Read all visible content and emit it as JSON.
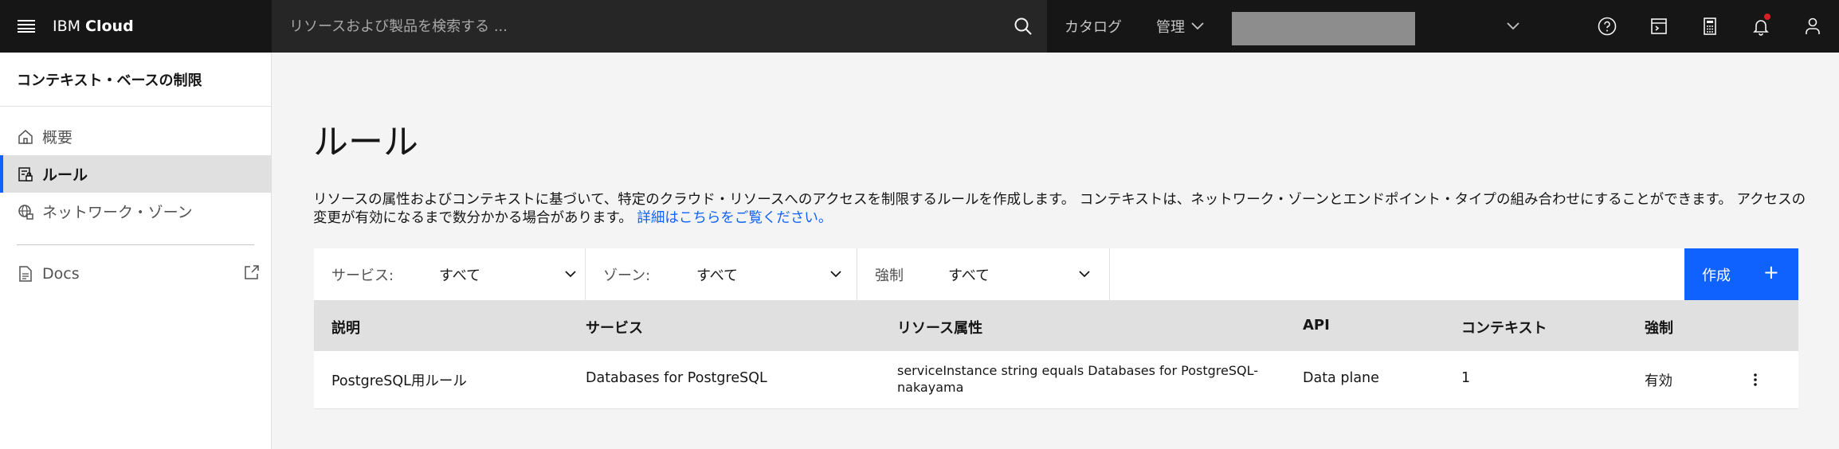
{
  "header": {
    "brand_prefix": "IBM",
    "brand_name": "Cloud",
    "search_placeholder": "リソースおよび製品を検索する ...",
    "catalog_label": "カタログ",
    "manage_label": "管理",
    "icons": [
      "hamburger-icon",
      "search-icon",
      "chevron-down-icon",
      "help-icon",
      "cost-estimator-icon",
      "calculator-icon",
      "notification-icon",
      "user-icon"
    ],
    "notification_dot_color": "#da1e28"
  },
  "sidebar": {
    "title": "コンテキスト・ベースの制限",
    "items": [
      {
        "label": "概要",
        "icon": "home-icon",
        "active": false
      },
      {
        "label": "ルール",
        "icon": "rule-icon",
        "active": true
      },
      {
        "label": "ネットワーク・ゾーン",
        "icon": "network-icon",
        "active": false
      }
    ],
    "docs_label": "Docs"
  },
  "main": {
    "title": "ルール",
    "description_line": "リソースの属性およびコンテキストに基づいて、特定のクラウド・リソースへのアクセスを制限するルールを作成します。 コンテキストは、ネットワーク・ゾーンとエンドポイント・タイプの組み合わせにすることができます。 アクセスの変更が有効になるまで数分かかる場合があります。",
    "description_link": "詳細はこちらをご覧ください。",
    "filters": [
      {
        "label": "サービス:",
        "value": "すべて"
      },
      {
        "label": "ゾーン:",
        "value": "すべて"
      },
      {
        "label": "強制",
        "value": "すべて"
      }
    ],
    "create_label": "作成",
    "create_plus": "+",
    "table": {
      "headers": [
        "説明",
        "サービス",
        "リソース属性",
        "API",
        "コンテキスト",
        "強制"
      ],
      "rows": [
        {
          "description": "PostgreSQL用ルール",
          "service": "Databases for PostgreSQL",
          "resource_attr": "serviceInstance string equals Databases for PostgreSQL-nakayama",
          "api": "Data plane",
          "contexts": "1",
          "enforcement": "有効"
        }
      ]
    }
  },
  "colors": {
    "header_bg": "#161616",
    "search_bg": "#262626",
    "accent": "#0f62fe",
    "page_bg": "#f4f4f4"
  }
}
